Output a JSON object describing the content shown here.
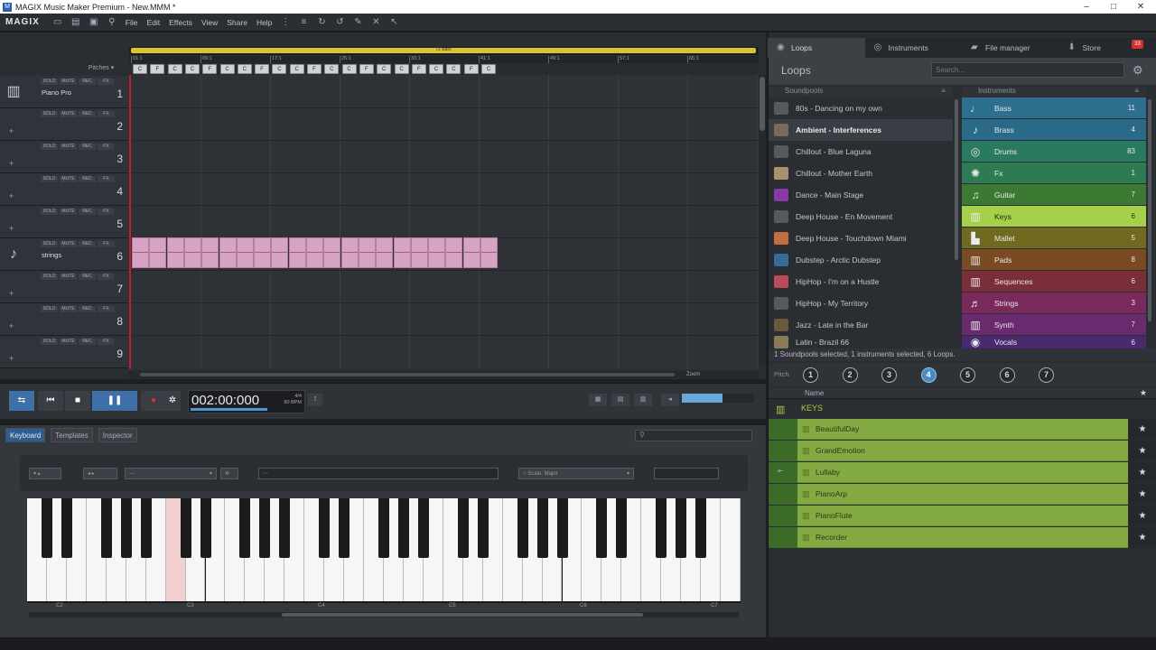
{
  "window": {
    "title": "MAGIX Music Maker Premium - New.MMM *",
    "minimize": "–",
    "maximize": "□",
    "close": "✕"
  },
  "menubar": {
    "logo": "MAGIX",
    "menus": [
      "File",
      "Edit",
      "Effects",
      "View",
      "Share",
      "Help"
    ]
  },
  "arrange": {
    "bars_label": "72 Bars",
    "ruler_marks": [
      "01:1",
      "09:1",
      "17:1",
      "25:1",
      "33:1",
      "41:1",
      "49:1",
      "57:1",
      "65:1"
    ],
    "pitches_label": "Pitches",
    "pitch_keys": [
      "C",
      "F",
      "C",
      "C",
      "F",
      "C",
      "C",
      "F",
      "C",
      "C",
      "F",
      "C",
      "C",
      "F",
      "C",
      "C",
      "F",
      "C",
      "C",
      "F",
      "C"
    ],
    "zoom_label": "Zoom",
    "track_buttons": {
      "solo": "SOLO",
      "mute": "MUTE",
      "rec": "REC",
      "fx": "FX"
    },
    "tracks": [
      {
        "num": "1",
        "name": "Piano Pro",
        "icon": "keyboard-icon"
      },
      {
        "num": "2",
        "name": ""
      },
      {
        "num": "3",
        "name": ""
      },
      {
        "num": "4",
        "name": ""
      },
      {
        "num": "5",
        "name": ""
      },
      {
        "num": "6",
        "name": "strings",
        "icon": "guitar-icon"
      },
      {
        "num": "7",
        "name": ""
      },
      {
        "num": "8",
        "name": ""
      },
      {
        "num": "9",
        "name": ""
      }
    ]
  },
  "transport": {
    "time": "002:00:000",
    "meter": "4/4",
    "bpm_value": "80",
    "bpm_label": "BPM"
  },
  "keyboard_panel": {
    "tabs": [
      "Keyboard",
      "Templates",
      "Inspector"
    ],
    "active_tab": "Keyboard",
    "preset_value": "---",
    "scale_label": "Scale: Major",
    "octave_labels": [
      "C2",
      "C3",
      "C4",
      "C5",
      "C6",
      "C7"
    ]
  },
  "right_panel": {
    "tabs": [
      {
        "label": "Loops",
        "icon": "loops-icon"
      },
      {
        "label": "Instruments",
        "icon": "instruments-icon"
      },
      {
        "label": "File manager",
        "icon": "folder-icon"
      },
      {
        "label": "Store",
        "icon": "store-icon"
      }
    ],
    "store_badge": "33",
    "section_title": "Loops",
    "search_placeholder": "Search...",
    "soundpools_header": "Soundpools",
    "instruments_header": "Instruments",
    "soundpools": [
      {
        "name": "80s - Dancing on my own",
        "selected": false
      },
      {
        "name": "Ambient - Interferences",
        "selected": true
      },
      {
        "name": "Chillout - Blue Laguna",
        "selected": false
      },
      {
        "name": "Chillout - Mother Earth",
        "selected": false
      },
      {
        "name": "Dance - Main Stage",
        "selected": false
      },
      {
        "name": "Deep House - En Movement",
        "selected": false
      },
      {
        "name": "Deep House - Touchdown Miami",
        "selected": false
      },
      {
        "name": "Dubstep - Arctic Dubstep",
        "selected": false
      },
      {
        "name": "HipHop - I'm on a Hustle",
        "selected": false
      },
      {
        "name": "HipHop - My Territory",
        "selected": false
      },
      {
        "name": "Jazz - Late in the Bar",
        "selected": false
      },
      {
        "name": "Latin - Brazil 66",
        "selected": false
      }
    ],
    "instruments": [
      {
        "name": "Bass",
        "count": "11",
        "color": "#2c6f8e",
        "icon": "bass-icon"
      },
      {
        "name": "Brass",
        "count": "4",
        "color": "#2a6a88",
        "icon": "brass-icon"
      },
      {
        "name": "Drums",
        "count": "83",
        "color": "#2a7a62",
        "icon": "drums-icon"
      },
      {
        "name": "Fx",
        "count": "1",
        "color": "#2e7a52",
        "icon": "fx-icon"
      },
      {
        "name": "Guitar",
        "count": "7",
        "color": "#3c7a34",
        "icon": "guitar-icon"
      },
      {
        "name": "Keys",
        "count": "6",
        "color": "#a6cf4a",
        "icon": "keys-icon",
        "selected": true
      },
      {
        "name": "Mallet",
        "count": "5",
        "color": "#6f6a20",
        "icon": "mallet-icon"
      },
      {
        "name": "Pads",
        "count": "8",
        "color": "#7a4a22",
        "icon": "pads-icon"
      },
      {
        "name": "Sequences",
        "count": "6",
        "color": "#7a2e3a",
        "icon": "sequences-icon"
      },
      {
        "name": "Strings",
        "count": "3",
        "color": "#7a2a5a",
        "icon": "strings-icon"
      },
      {
        "name": "Synth",
        "count": "7",
        "color": "#6a2a6e",
        "icon": "synth-icon"
      },
      {
        "name": "Vocals",
        "count": "6",
        "color": "#4a2a6e",
        "icon": "vocals-icon"
      }
    ],
    "status": "1 Soundpools selected, 1 instruments selected, 6 Loops.",
    "pitch_label": "Pitch",
    "pitch_numbers": [
      "1",
      "2",
      "3",
      "4",
      "5",
      "6",
      "7"
    ],
    "active_pitch": "4",
    "name_header": "Name",
    "category": "KEYS",
    "loops": [
      "BeautifulDay",
      "GrandEmotion",
      "Lullaby",
      "PianoArp",
      "PianoFlute",
      "Recorder"
    ]
  }
}
